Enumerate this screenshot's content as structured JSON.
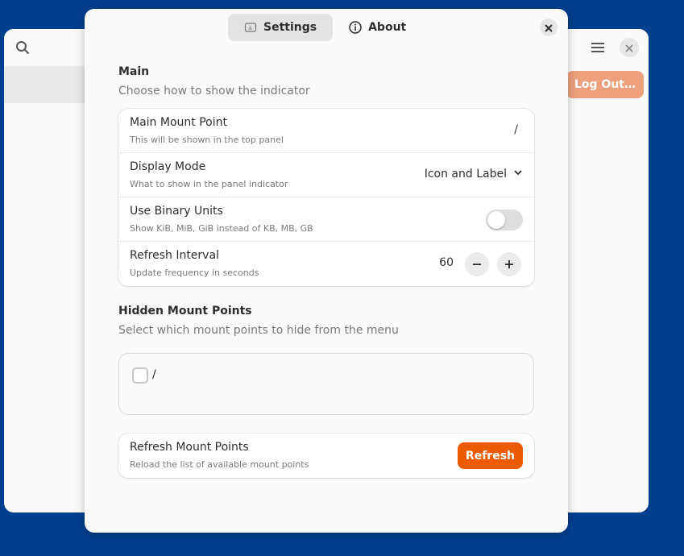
{
  "background_window": {
    "logout_label": "Log Out…",
    "icons": [
      "search-icon",
      "hamburger-menu-icon",
      "close-icon"
    ]
  },
  "dialog": {
    "tabs": [
      {
        "label": "Settings",
        "icon": "preferences-icon",
        "active": true
      },
      {
        "label": "About",
        "icon": "info-icon",
        "active": false
      }
    ],
    "main": {
      "title": "Main",
      "subtitle": "Choose how to show the indicator",
      "rows": {
        "mount_point": {
          "title": "Main Mount Point",
          "subtitle": "This will be shown in the top panel",
          "value": "/"
        },
        "display_mode": {
          "title": "Display Mode",
          "subtitle": "What to show in the panel indicator",
          "value": "Icon and Label"
        },
        "binary_units": {
          "title": "Use Binary Units",
          "subtitle": "Show KiB, MiB, GiB instead of KB, MB, GB",
          "enabled": false
        },
        "refresh_interval": {
          "title": "Refresh Interval",
          "subtitle": "Update frequency in seconds",
          "value": "60"
        }
      }
    },
    "hidden": {
      "title": "Hidden Mount Points",
      "subtitle": "Select which mount points to hide from the menu",
      "items": [
        {
          "label": "/",
          "checked": false
        }
      ]
    },
    "refresh": {
      "title": "Refresh Mount Points",
      "subtitle": "Reload the list of available mount points",
      "button_label": "Refresh"
    }
  },
  "colors": {
    "desktop": "#003f8e",
    "accent": "#ed5b00",
    "logout_faded": "#eda07b"
  }
}
